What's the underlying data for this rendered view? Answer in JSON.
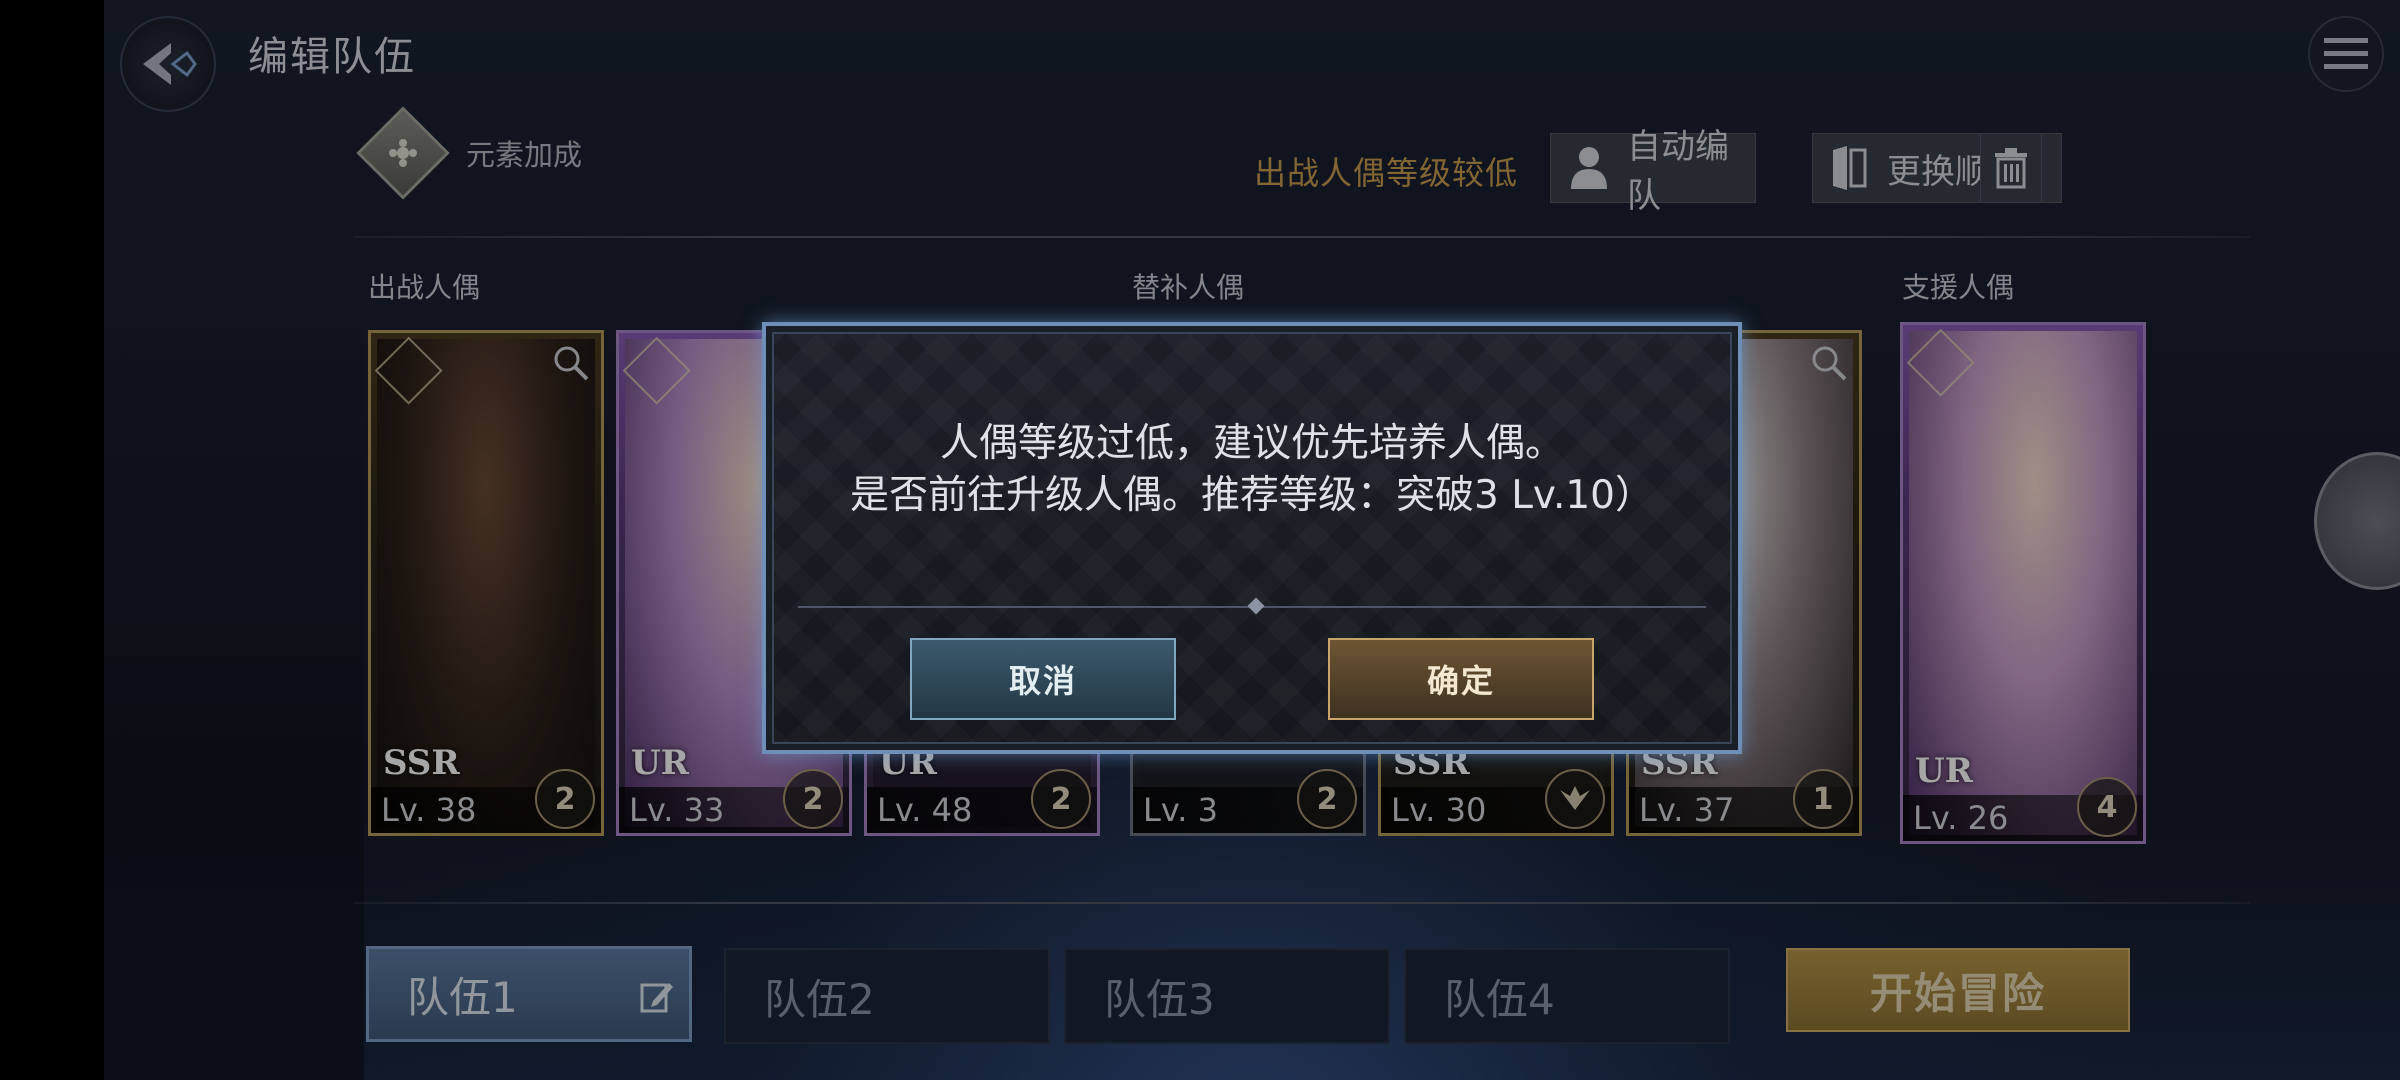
{
  "header": {
    "title": "编辑队伍"
  },
  "toolbar": {
    "element_bonus_label": "元素加成",
    "warning": "出战人偶等级较低",
    "auto_team_label": "自动编队",
    "change_order_label": "更换顺序"
  },
  "sections": {
    "battle": "出战人偶",
    "substitute": "替补人偶",
    "support": "支援人偶"
  },
  "cards": [
    {
      "rarity": "SSR",
      "level": "Lv. 38",
      "stars": "2",
      "frame": "gold"
    },
    {
      "rarity": "UR",
      "level": "Lv. 33",
      "stars": "2",
      "frame": "purple"
    },
    {
      "rarity": "UR",
      "level": "Lv. 48",
      "stars": "2",
      "frame": "purple"
    },
    {
      "rarity": "",
      "level": "Lv.  3",
      "stars": "2",
      "frame": "grey"
    },
    {
      "rarity": "SSR",
      "level": "Lv. 30",
      "stars": "",
      "frame": "gold"
    },
    {
      "rarity": "SSR",
      "level": "Lv. 37",
      "stars": "1",
      "frame": "gold"
    },
    {
      "rarity": "UR",
      "level": "Lv. 26",
      "stars": "4",
      "frame": "purple"
    }
  ],
  "teams": {
    "tabs": [
      "队伍1",
      "队伍2",
      "队伍3",
      "队伍4"
    ],
    "active_index": 0
  },
  "start_button": "开始冒险",
  "dialog": {
    "line1": "人偶等级过低，建议优先培养人偶。",
    "line2": "是否前往升级人偶。推荐等级：突破3 Lv.10）",
    "cancel": "取消",
    "confirm": "确定"
  },
  "colors": {
    "accent_gold": "#c79c4f",
    "dialog_border": "#6d8fb8",
    "team_active": "#5c7aa0"
  }
}
